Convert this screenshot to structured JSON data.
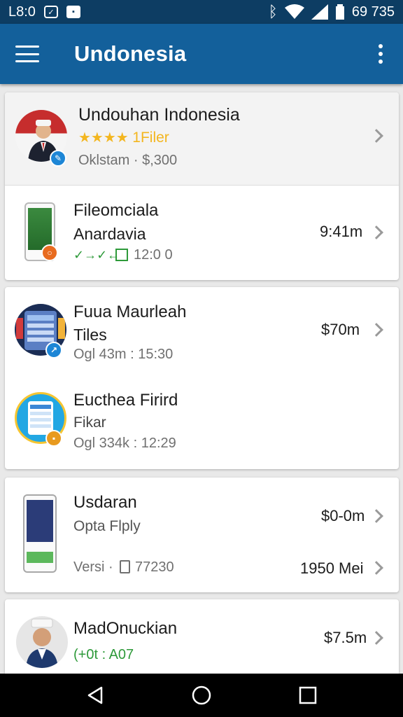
{
  "status_bar": {
    "time": "L8:0",
    "right_text": "69 735"
  },
  "app_bar": {
    "title": "Undonesia"
  },
  "items": [
    {
      "title": "Undouhan Indonesia",
      "rating_text": "1Filer",
      "meta": "Oklstam · $,300"
    },
    {
      "title": "Fileomciala",
      "subtitle": "Anardavia",
      "tag": "✓→✓←",
      "meta": "12:0 0",
      "value": "9:41m"
    },
    {
      "title": "Fuua Maurleah",
      "subtitle": "Tiles",
      "meta": "Ogl 43m : 15:30",
      "value": "$70m"
    },
    {
      "title": "Eucthea Firird",
      "subtitle": "Fikar",
      "meta": "Ogl 334k : 12:29"
    },
    {
      "title": "Usdaran",
      "subtitle": "Opta Flply",
      "meta_label": "Versi ·",
      "meta_value": "77230",
      "value": "$0-0m",
      "value2": "1950 Mei"
    },
    {
      "title": "MadOnuckian",
      "meta": "(+0t : A07",
      "value": "$7.5m"
    }
  ],
  "colors": {
    "status_bar": "#0d3d63",
    "app_bar": "#13609b",
    "star": "#f3b61f",
    "green": "#2e9a3a"
  }
}
